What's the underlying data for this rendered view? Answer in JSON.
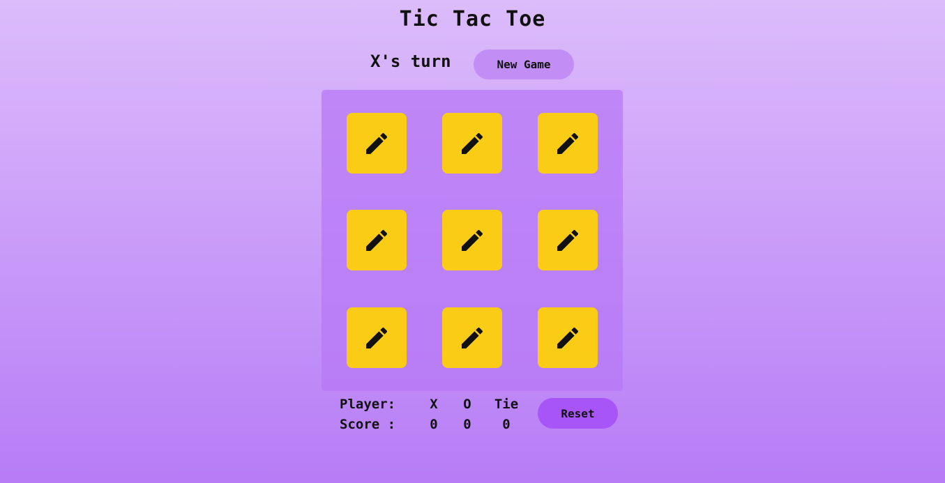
{
  "title": "Tic Tac Toe",
  "status": {
    "turn_text": "X's turn"
  },
  "controls": {
    "new_game_label": "New Game",
    "reset_label": "Reset"
  },
  "board": {
    "cells": [
      {
        "icon": "pencil-icon"
      },
      {
        "icon": "pencil-icon"
      },
      {
        "icon": "pencil-icon"
      },
      {
        "icon": "pencil-icon"
      },
      {
        "icon": "pencil-icon"
      },
      {
        "icon": "pencil-icon"
      },
      {
        "icon": "pencil-icon"
      },
      {
        "icon": "pencil-icon"
      },
      {
        "icon": "pencil-icon"
      }
    ],
    "cell_color": "#facc15"
  },
  "scoreboard": {
    "player_label": "Player:",
    "score_label": "Score :",
    "headers": [
      "X",
      "O",
      "Tie"
    ],
    "scores": [
      "0",
      "0",
      "0"
    ]
  },
  "colors": {
    "background_top": "#dcbcfb",
    "background_bottom": "#b77cf6",
    "new_game_button": "#c28ef6",
    "reset_button": "#a855f7"
  }
}
